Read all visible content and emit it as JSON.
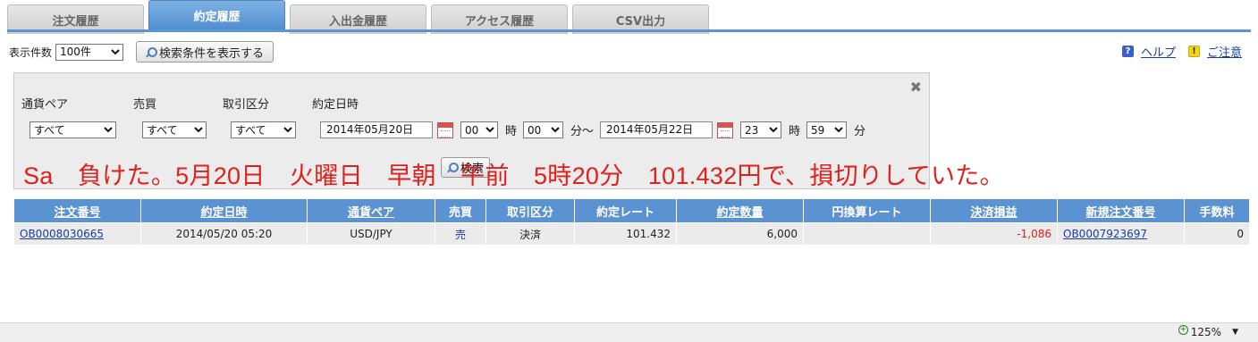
{
  "tabs": [
    {
      "label": "注文履歴",
      "active": false
    },
    {
      "label": "約定履歴",
      "active": true
    },
    {
      "label": "入出金履歴",
      "active": false
    },
    {
      "label": "アクセス履歴",
      "active": false
    },
    {
      "label": "CSV出力",
      "active": false
    }
  ],
  "toolbar": {
    "count_label": "表示件数",
    "count_value": "100件",
    "show_conditions_label": "検索条件を表示する"
  },
  "help": {
    "help_label": "ヘルプ",
    "caution_label": "ご注意",
    "help_icon": "?",
    "caution_icon": "!"
  },
  "search": {
    "close_glyph": "✖",
    "pair_label": "通貨ペア",
    "side_label": "売買",
    "type_label": "取引区分",
    "datetime_label": "約定日時",
    "pair_value": "すべて",
    "side_value": "すべて",
    "type_value": "すべて",
    "from_date": "2014年05月20日",
    "from_hour": "00",
    "from_min": "00",
    "to_date": "2014年05月22日",
    "to_hour": "23",
    "to_min": "59",
    "hour_unit": "時",
    "min_unit": "分",
    "min_tilde": "分～",
    "search_button": "検索"
  },
  "annotation": "Sa　負けた。5月20日　火曜日　早朝　午前　5時20分　101.432円で、損切りしていた。",
  "table": {
    "headers": [
      "注文番号",
      "約定日時",
      "通貨ペア",
      "売買",
      "取引区分",
      "約定レート",
      "約定数量",
      "円換算レート",
      "決済損益",
      "新規注文番号",
      "手数料"
    ],
    "row": {
      "order_no": "OB0008030665",
      "datetime": "2014/05/20 05:20",
      "pair": "USD/JPY",
      "side": "売",
      "type": "決済",
      "rate": "101.432",
      "qty": "6,000",
      "yen_rate": "",
      "pnl": "-1,086",
      "new_order_no": "OB0007923697",
      "fee": "0"
    }
  },
  "status": {
    "zoom": "125%",
    "zoom_caret": "▼"
  },
  "colors": {
    "tab_active": "#5b92d2",
    "header_bg": "#5b92d2",
    "annotation": "#e0201c",
    "negative": "#e0201c",
    "link": "#1a3c9c"
  }
}
